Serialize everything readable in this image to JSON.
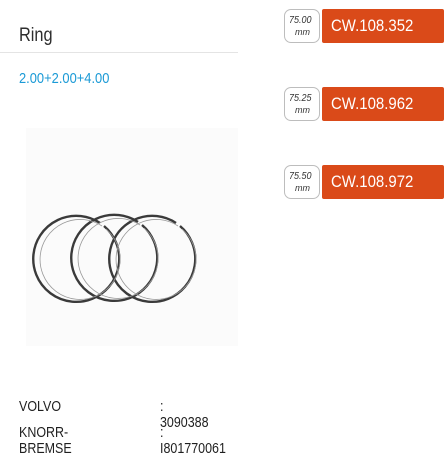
{
  "product": {
    "title": "Ring",
    "spec": "2.00+2.00+4.00"
  },
  "references": [
    {
      "name": "VOLVO",
      "number": ": 3090388"
    },
    {
      "name": "KNORR-BREMSE",
      "number": ": I801770061"
    }
  ],
  "variants": [
    {
      "size": "75.00",
      "unit": "mm",
      "code": "CW.108.352"
    },
    {
      "size": "75.25",
      "unit": "mm",
      "code": "CW.108.962"
    },
    {
      "size": "75.50",
      "unit": "mm",
      "code": "CW.108.972"
    }
  ],
  "colors": {
    "accent": "#da4a19",
    "spec_text": "#1b9ad6",
    "title_text": "#2e2e2e"
  },
  "icons": {
    "product_image": "piston-rings-illustration"
  }
}
